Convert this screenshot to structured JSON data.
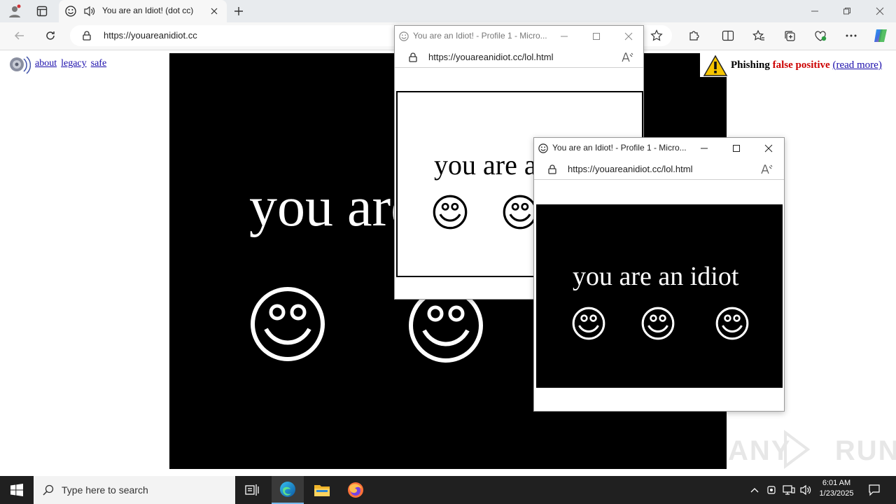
{
  "browser": {
    "tab_title": "You are an Idiot! (dot cc)",
    "url": "https://youareanidiot.cc"
  },
  "page": {
    "links": [
      "about",
      "legacy",
      "safe"
    ],
    "phishing": {
      "label": "Phishing",
      "highlight": "false positive",
      "link": "(read more)"
    },
    "big_text": "you are an idiot"
  },
  "popup1": {
    "title": "You are an Idiot! - Profile 1 - Micro...",
    "url": "https://youareanidiot.cc/lol.html",
    "text": "you are an idiot"
  },
  "popup2": {
    "title": "You are an Idiot! - Profile 1 - Micro...",
    "url": "https://youareanidiot.cc/lol.html",
    "text": "you are an idiot"
  },
  "taskbar": {
    "search_placeholder": "Type here to search",
    "time": "6:01 AM",
    "date": "1/23/2025"
  },
  "watermark": "ANY RUN",
  "colors": {
    "edge_accent": "#0078d4",
    "phishing_red": "#cc0000"
  }
}
